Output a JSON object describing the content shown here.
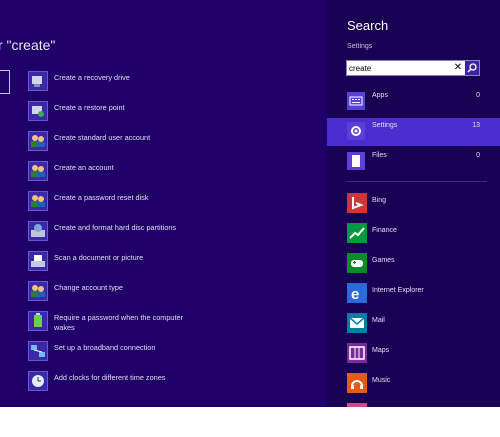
{
  "results": {
    "title": "r \"create\"",
    "items": [
      {
        "label": "Create a recovery drive",
        "icon": "recovery-drive-icon"
      },
      {
        "label": "Create a restore point",
        "icon": "restore-point-icon"
      },
      {
        "label": "Create standard user account",
        "icon": "user-account-icon"
      },
      {
        "label": "Create an account",
        "icon": "user-account-icon"
      },
      {
        "label": "Create a password reset disk",
        "icon": "user-account-icon"
      },
      {
        "label": "Create and format hard disc partitions",
        "icon": "disk-management-icon"
      },
      {
        "label": "Scan a document or picture",
        "icon": "scanner-icon"
      },
      {
        "label": "Change account type",
        "icon": "user-account-icon"
      },
      {
        "label": "Require a password when the computer wakes",
        "icon": "power-battery-icon"
      },
      {
        "label": "Set up a broadband connection",
        "icon": "network-icon"
      },
      {
        "label": "Add clocks for different time zones",
        "icon": "clock-icon"
      }
    ]
  },
  "charm": {
    "title": "Search",
    "scope": "Settings",
    "search": {
      "value": "create",
      "placeholder": ""
    },
    "categories": [
      {
        "label": "Apps",
        "count": "0",
        "icon": "keyboard-apps-icon"
      },
      {
        "label": "Settings",
        "count": "13",
        "icon": "gear-icon"
      },
      {
        "label": "Files",
        "count": "0",
        "icon": "file-icon"
      }
    ],
    "apps": [
      {
        "label": "Bing",
        "icon": "bing-icon",
        "color": "#d13438"
      },
      {
        "label": "Finance",
        "icon": "finance-icon",
        "color": "#009a3e"
      },
      {
        "label": "Games",
        "icon": "games-icon",
        "color": "#0d8a2a"
      },
      {
        "label": "Internet Explorer",
        "icon": "internet-explorer-icon",
        "color": "#2b6ad9"
      },
      {
        "label": "Mail",
        "icon": "mail-icon",
        "color": "#007ea7"
      },
      {
        "label": "Maps",
        "icon": "maps-icon",
        "color": "#7a2a9a"
      },
      {
        "label": "Music",
        "icon": "music-icon",
        "color": "#e55b13"
      }
    ]
  },
  "colors": {
    "background": "#1f0068",
    "charm": "#180052",
    "selected": "#4a2ed0"
  }
}
